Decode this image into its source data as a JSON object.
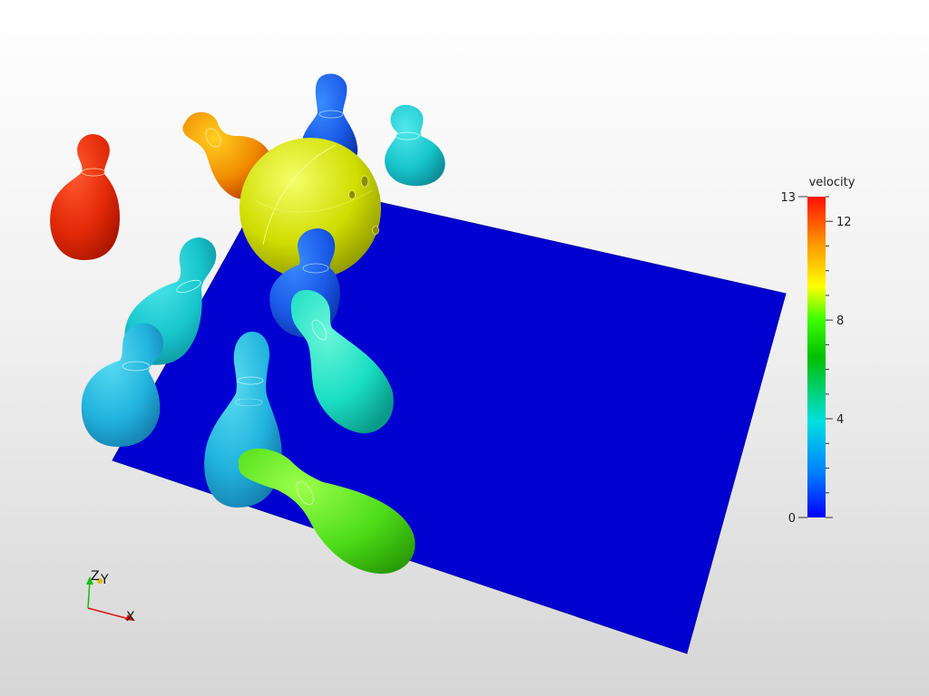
{
  "colorbar": {
    "title": "velocity",
    "range": [
      0,
      13
    ],
    "tick_labels": [
      "13",
      "12",
      "8",
      "4",
      "0"
    ],
    "colormap": [
      "#0000ff",
      "#0080ff",
      "#00e0e0",
      "#00c000",
      "#40ff00",
      "#ffff00",
      "#ff9000",
      "#ff1000"
    ]
  },
  "axes": {
    "x_label": "X",
    "y_label": "Y",
    "z_label": "Z",
    "x_color": "#e01010",
    "y_color": "#e0e000",
    "z_color": "#10c010"
  },
  "scene": {
    "floor_color": "#0000d0",
    "objects": [
      {
        "name": "bowling-ball",
        "color": "#d2e000"
      },
      {
        "name": "pin-red",
        "color": "#e62a0a"
      },
      {
        "name": "pin-orange",
        "color": "#ee8c00"
      },
      {
        "name": "pin-blue-back",
        "color": "#1a5fe6"
      },
      {
        "name": "pin-teal-back",
        "color": "#1bcfd6"
      },
      {
        "name": "pin-cyan-left",
        "color": "#22c4d8"
      },
      {
        "name": "pin-blue-center",
        "color": "#1a5ae8"
      },
      {
        "name": "pin-cyan-lower-left",
        "color": "#22b4de"
      },
      {
        "name": "pin-cyan-tilted",
        "color": "#1ae0c8"
      },
      {
        "name": "pin-cyan-standing",
        "color": "#1faee0"
      },
      {
        "name": "pin-green-fallen",
        "color": "#4ddd18"
      }
    ]
  }
}
